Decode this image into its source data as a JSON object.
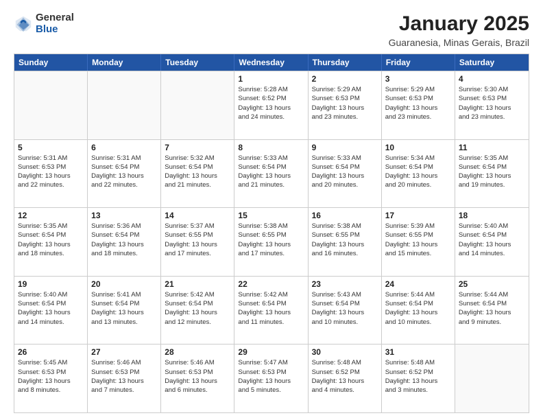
{
  "logo": {
    "general": "General",
    "blue": "Blue"
  },
  "header": {
    "title": "January 2025",
    "subtitle": "Guaranesia, Minas Gerais, Brazil"
  },
  "weekdays": [
    "Sunday",
    "Monday",
    "Tuesday",
    "Wednesday",
    "Thursday",
    "Friday",
    "Saturday"
  ],
  "weeks": [
    [
      {
        "day": "",
        "info": "",
        "empty": true
      },
      {
        "day": "",
        "info": "",
        "empty": true
      },
      {
        "day": "",
        "info": "",
        "empty": true
      },
      {
        "day": "1",
        "info": "Sunrise: 5:28 AM\nSunset: 6:52 PM\nDaylight: 13 hours\nand 24 minutes.",
        "empty": false
      },
      {
        "day": "2",
        "info": "Sunrise: 5:29 AM\nSunset: 6:53 PM\nDaylight: 13 hours\nand 23 minutes.",
        "empty": false
      },
      {
        "day": "3",
        "info": "Sunrise: 5:29 AM\nSunset: 6:53 PM\nDaylight: 13 hours\nand 23 minutes.",
        "empty": false
      },
      {
        "day": "4",
        "info": "Sunrise: 5:30 AM\nSunset: 6:53 PM\nDaylight: 13 hours\nand 23 minutes.",
        "empty": false
      }
    ],
    [
      {
        "day": "5",
        "info": "Sunrise: 5:31 AM\nSunset: 6:53 PM\nDaylight: 13 hours\nand 22 minutes.",
        "empty": false
      },
      {
        "day": "6",
        "info": "Sunrise: 5:31 AM\nSunset: 6:54 PM\nDaylight: 13 hours\nand 22 minutes.",
        "empty": false
      },
      {
        "day": "7",
        "info": "Sunrise: 5:32 AM\nSunset: 6:54 PM\nDaylight: 13 hours\nand 21 minutes.",
        "empty": false
      },
      {
        "day": "8",
        "info": "Sunrise: 5:33 AM\nSunset: 6:54 PM\nDaylight: 13 hours\nand 21 minutes.",
        "empty": false
      },
      {
        "day": "9",
        "info": "Sunrise: 5:33 AM\nSunset: 6:54 PM\nDaylight: 13 hours\nand 20 minutes.",
        "empty": false
      },
      {
        "day": "10",
        "info": "Sunrise: 5:34 AM\nSunset: 6:54 PM\nDaylight: 13 hours\nand 20 minutes.",
        "empty": false
      },
      {
        "day": "11",
        "info": "Sunrise: 5:35 AM\nSunset: 6:54 PM\nDaylight: 13 hours\nand 19 minutes.",
        "empty": false
      }
    ],
    [
      {
        "day": "12",
        "info": "Sunrise: 5:35 AM\nSunset: 6:54 PM\nDaylight: 13 hours\nand 18 minutes.",
        "empty": false
      },
      {
        "day": "13",
        "info": "Sunrise: 5:36 AM\nSunset: 6:54 PM\nDaylight: 13 hours\nand 18 minutes.",
        "empty": false
      },
      {
        "day": "14",
        "info": "Sunrise: 5:37 AM\nSunset: 6:55 PM\nDaylight: 13 hours\nand 17 minutes.",
        "empty": false
      },
      {
        "day": "15",
        "info": "Sunrise: 5:38 AM\nSunset: 6:55 PM\nDaylight: 13 hours\nand 17 minutes.",
        "empty": false
      },
      {
        "day": "16",
        "info": "Sunrise: 5:38 AM\nSunset: 6:55 PM\nDaylight: 13 hours\nand 16 minutes.",
        "empty": false
      },
      {
        "day": "17",
        "info": "Sunrise: 5:39 AM\nSunset: 6:55 PM\nDaylight: 13 hours\nand 15 minutes.",
        "empty": false
      },
      {
        "day": "18",
        "info": "Sunrise: 5:40 AM\nSunset: 6:54 PM\nDaylight: 13 hours\nand 14 minutes.",
        "empty": false
      }
    ],
    [
      {
        "day": "19",
        "info": "Sunrise: 5:40 AM\nSunset: 6:54 PM\nDaylight: 13 hours\nand 14 minutes.",
        "empty": false
      },
      {
        "day": "20",
        "info": "Sunrise: 5:41 AM\nSunset: 6:54 PM\nDaylight: 13 hours\nand 13 minutes.",
        "empty": false
      },
      {
        "day": "21",
        "info": "Sunrise: 5:42 AM\nSunset: 6:54 PM\nDaylight: 13 hours\nand 12 minutes.",
        "empty": false
      },
      {
        "day": "22",
        "info": "Sunrise: 5:42 AM\nSunset: 6:54 PM\nDaylight: 13 hours\nand 11 minutes.",
        "empty": false
      },
      {
        "day": "23",
        "info": "Sunrise: 5:43 AM\nSunset: 6:54 PM\nDaylight: 13 hours\nand 10 minutes.",
        "empty": false
      },
      {
        "day": "24",
        "info": "Sunrise: 5:44 AM\nSunset: 6:54 PM\nDaylight: 13 hours\nand 10 minutes.",
        "empty": false
      },
      {
        "day": "25",
        "info": "Sunrise: 5:44 AM\nSunset: 6:54 PM\nDaylight: 13 hours\nand 9 minutes.",
        "empty": false
      }
    ],
    [
      {
        "day": "26",
        "info": "Sunrise: 5:45 AM\nSunset: 6:53 PM\nDaylight: 13 hours\nand 8 minutes.",
        "empty": false
      },
      {
        "day": "27",
        "info": "Sunrise: 5:46 AM\nSunset: 6:53 PM\nDaylight: 13 hours\nand 7 minutes.",
        "empty": false
      },
      {
        "day": "28",
        "info": "Sunrise: 5:46 AM\nSunset: 6:53 PM\nDaylight: 13 hours\nand 6 minutes.",
        "empty": false
      },
      {
        "day": "29",
        "info": "Sunrise: 5:47 AM\nSunset: 6:53 PM\nDaylight: 13 hours\nand 5 minutes.",
        "empty": false
      },
      {
        "day": "30",
        "info": "Sunrise: 5:48 AM\nSunset: 6:52 PM\nDaylight: 13 hours\nand 4 minutes.",
        "empty": false
      },
      {
        "day": "31",
        "info": "Sunrise: 5:48 AM\nSunset: 6:52 PM\nDaylight: 13 hours\nand 3 minutes.",
        "empty": false
      },
      {
        "day": "",
        "info": "",
        "empty": true
      }
    ]
  ]
}
